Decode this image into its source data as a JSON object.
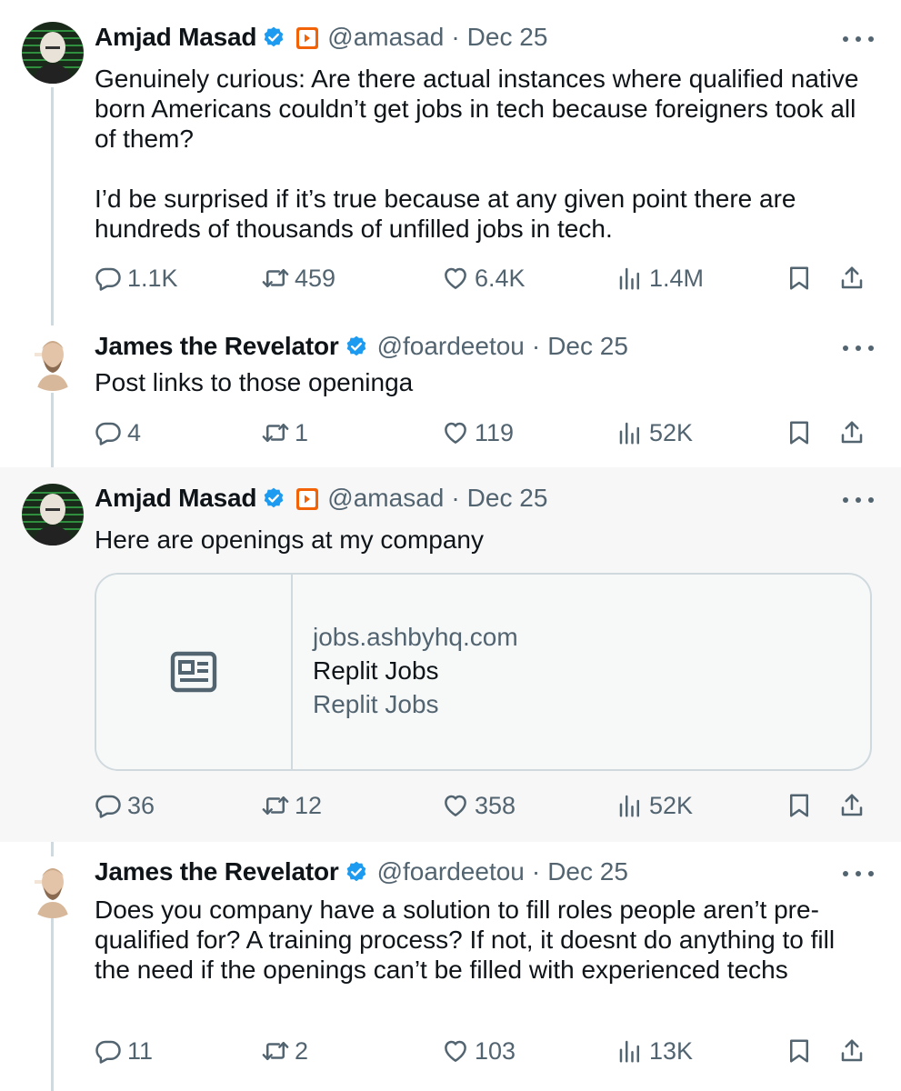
{
  "tweets": [
    {
      "author": "Amjad Masad",
      "handle": "@amasad",
      "separator": "·",
      "date": "Dec 25",
      "text": "Genuinely curious: Are there actual instances where qualified native born Americans couldn’t get jobs in tech because foreigners took all of them?\n\nI’d be surprised if it’s true because at any given point there are hundreds of thousands of unfilled jobs in tech.",
      "replies": "1.1K",
      "reposts": "459",
      "likes": "6.4K",
      "views": "1.4M"
    },
    {
      "author": "James the Revelator",
      "handle": "@foardeetou",
      "separator": "·",
      "date": "Dec 25",
      "text": "Post links to those openinga",
      "replies": "4",
      "reposts": "1",
      "likes": "119",
      "views": "52K"
    },
    {
      "author": "Amjad Masad",
      "handle": "@amasad",
      "separator": "·",
      "date": "Dec 25",
      "text": "Here are openings at my company",
      "card": {
        "domain": "jobs.ashbyhq.com",
        "title": "Replit Jobs",
        "description": "Replit Jobs"
      },
      "replies": "36",
      "reposts": "12",
      "likes": "358",
      "views": "52K"
    },
    {
      "author": "James the Revelator",
      "handle": "@foardeetou",
      "separator": "·",
      "date": "Dec 25",
      "text": "Does you company have a solution to fill roles people aren’t pre-qualified for? A training process? If not, it doesnt do anything to fill the need if the openings can’t be filled with experienced techs",
      "replies": "11",
      "reposts": "2",
      "likes": "103",
      "views": "13K"
    }
  ],
  "icons": {
    "verified": "verified-badge-icon",
    "affiliation": "replit-affiliate-icon",
    "more": "more-options-icon",
    "reply": "reply-icon",
    "repost": "repost-icon",
    "like": "heart-icon",
    "views": "views-chart-icon",
    "bookmark": "bookmark-icon",
    "share": "share-icon",
    "card": "article-icon"
  },
  "colors": {
    "verified_blue": "#1d9bf0",
    "replit_orange": "#f26207",
    "secondary_text": "#536471",
    "primary_text": "#0f1419",
    "highlight_bg": "#f7f7f7"
  }
}
